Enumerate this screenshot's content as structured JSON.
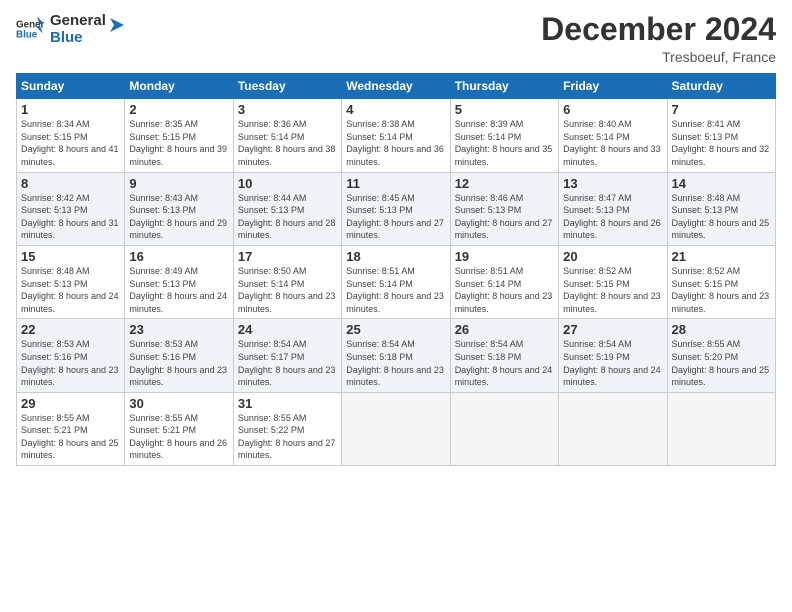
{
  "logo": {
    "text_general": "General",
    "text_blue": "Blue"
  },
  "header": {
    "month": "December 2024",
    "location": "Tresboeuf, France"
  },
  "columns": [
    "Sunday",
    "Monday",
    "Tuesday",
    "Wednesday",
    "Thursday",
    "Friday",
    "Saturday"
  ],
  "weeks": [
    [
      {
        "day": "1",
        "sunrise": "Sunrise: 8:34 AM",
        "sunset": "Sunset: 5:15 PM",
        "daylight": "Daylight: 8 hours and 41 minutes."
      },
      {
        "day": "2",
        "sunrise": "Sunrise: 8:35 AM",
        "sunset": "Sunset: 5:15 PM",
        "daylight": "Daylight: 8 hours and 39 minutes."
      },
      {
        "day": "3",
        "sunrise": "Sunrise: 8:36 AM",
        "sunset": "Sunset: 5:14 PM",
        "daylight": "Daylight: 8 hours and 38 minutes."
      },
      {
        "day": "4",
        "sunrise": "Sunrise: 8:38 AM",
        "sunset": "Sunset: 5:14 PM",
        "daylight": "Daylight: 8 hours and 36 minutes."
      },
      {
        "day": "5",
        "sunrise": "Sunrise: 8:39 AM",
        "sunset": "Sunset: 5:14 PM",
        "daylight": "Daylight: 8 hours and 35 minutes."
      },
      {
        "day": "6",
        "sunrise": "Sunrise: 8:40 AM",
        "sunset": "Sunset: 5:14 PM",
        "daylight": "Daylight: 8 hours and 33 minutes."
      },
      {
        "day": "7",
        "sunrise": "Sunrise: 8:41 AM",
        "sunset": "Sunset: 5:13 PM",
        "daylight": "Daylight: 8 hours and 32 minutes."
      }
    ],
    [
      {
        "day": "8",
        "sunrise": "Sunrise: 8:42 AM",
        "sunset": "Sunset: 5:13 PM",
        "daylight": "Daylight: 8 hours and 31 minutes."
      },
      {
        "day": "9",
        "sunrise": "Sunrise: 8:43 AM",
        "sunset": "Sunset: 5:13 PM",
        "daylight": "Daylight: 8 hours and 29 minutes."
      },
      {
        "day": "10",
        "sunrise": "Sunrise: 8:44 AM",
        "sunset": "Sunset: 5:13 PM",
        "daylight": "Daylight: 8 hours and 28 minutes."
      },
      {
        "day": "11",
        "sunrise": "Sunrise: 8:45 AM",
        "sunset": "Sunset: 5:13 PM",
        "daylight": "Daylight: 8 hours and 27 minutes."
      },
      {
        "day": "12",
        "sunrise": "Sunrise: 8:46 AM",
        "sunset": "Sunset: 5:13 PM",
        "daylight": "Daylight: 8 hours and 27 minutes."
      },
      {
        "day": "13",
        "sunrise": "Sunrise: 8:47 AM",
        "sunset": "Sunset: 5:13 PM",
        "daylight": "Daylight: 8 hours and 26 minutes."
      },
      {
        "day": "14",
        "sunrise": "Sunrise: 8:48 AM",
        "sunset": "Sunset: 5:13 PM",
        "daylight": "Daylight: 8 hours and 25 minutes."
      }
    ],
    [
      {
        "day": "15",
        "sunrise": "Sunrise: 8:48 AM",
        "sunset": "Sunset: 5:13 PM",
        "daylight": "Daylight: 8 hours and 24 minutes."
      },
      {
        "day": "16",
        "sunrise": "Sunrise: 8:49 AM",
        "sunset": "Sunset: 5:13 PM",
        "daylight": "Daylight: 8 hours and 24 minutes."
      },
      {
        "day": "17",
        "sunrise": "Sunrise: 8:50 AM",
        "sunset": "Sunset: 5:14 PM",
        "daylight": "Daylight: 8 hours and 23 minutes."
      },
      {
        "day": "18",
        "sunrise": "Sunrise: 8:51 AM",
        "sunset": "Sunset: 5:14 PM",
        "daylight": "Daylight: 8 hours and 23 minutes."
      },
      {
        "day": "19",
        "sunrise": "Sunrise: 8:51 AM",
        "sunset": "Sunset: 5:14 PM",
        "daylight": "Daylight: 8 hours and 23 minutes."
      },
      {
        "day": "20",
        "sunrise": "Sunrise: 8:52 AM",
        "sunset": "Sunset: 5:15 PM",
        "daylight": "Daylight: 8 hours and 23 minutes."
      },
      {
        "day": "21",
        "sunrise": "Sunrise: 8:52 AM",
        "sunset": "Sunset: 5:15 PM",
        "daylight": "Daylight: 8 hours and 23 minutes."
      }
    ],
    [
      {
        "day": "22",
        "sunrise": "Sunrise: 8:53 AM",
        "sunset": "Sunset: 5:16 PM",
        "daylight": "Daylight: 8 hours and 23 minutes."
      },
      {
        "day": "23",
        "sunrise": "Sunrise: 8:53 AM",
        "sunset": "Sunset: 5:16 PM",
        "daylight": "Daylight: 8 hours and 23 minutes."
      },
      {
        "day": "24",
        "sunrise": "Sunrise: 8:54 AM",
        "sunset": "Sunset: 5:17 PM",
        "daylight": "Daylight: 8 hours and 23 minutes."
      },
      {
        "day": "25",
        "sunrise": "Sunrise: 8:54 AM",
        "sunset": "Sunset: 5:18 PM",
        "daylight": "Daylight: 8 hours and 23 minutes."
      },
      {
        "day": "26",
        "sunrise": "Sunrise: 8:54 AM",
        "sunset": "Sunset: 5:18 PM",
        "daylight": "Daylight: 8 hours and 24 minutes."
      },
      {
        "day": "27",
        "sunrise": "Sunrise: 8:54 AM",
        "sunset": "Sunset: 5:19 PM",
        "daylight": "Daylight: 8 hours and 24 minutes."
      },
      {
        "day": "28",
        "sunrise": "Sunrise: 8:55 AM",
        "sunset": "Sunset: 5:20 PM",
        "daylight": "Daylight: 8 hours and 25 minutes."
      }
    ],
    [
      {
        "day": "29",
        "sunrise": "Sunrise: 8:55 AM",
        "sunset": "Sunset: 5:21 PM",
        "daylight": "Daylight: 8 hours and 25 minutes."
      },
      {
        "day": "30",
        "sunrise": "Sunrise: 8:55 AM",
        "sunset": "Sunset: 5:21 PM",
        "daylight": "Daylight: 8 hours and 26 minutes."
      },
      {
        "day": "31",
        "sunrise": "Sunrise: 8:55 AM",
        "sunset": "Sunset: 5:22 PM",
        "daylight": "Daylight: 8 hours and 27 minutes."
      },
      null,
      null,
      null,
      null
    ]
  ]
}
